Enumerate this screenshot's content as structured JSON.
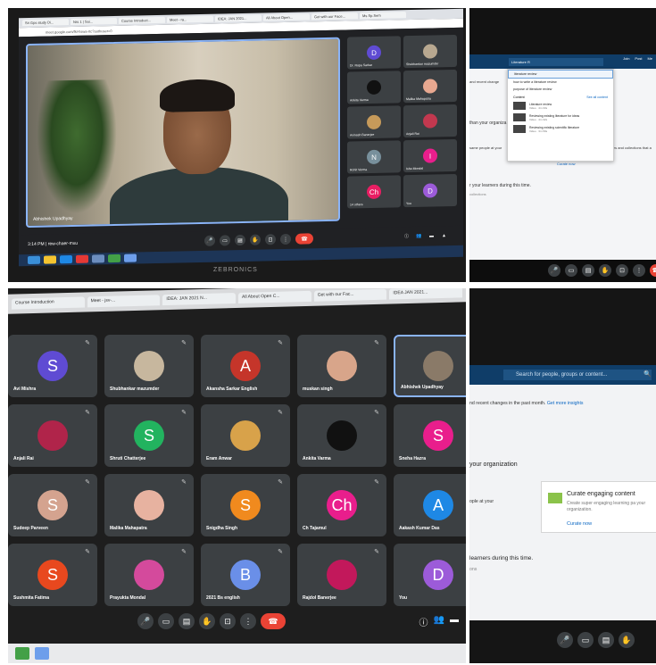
{
  "panel1": {
    "tabs": [
      "Sri Gps study Di...",
      "Nrs 1 | Sai...",
      "Course Introduct...",
      "Meet - ra...",
      "IDEA: JAN 2021...",
      "All About Open...",
      "Get with our Face...",
      "Ms Sp.Sem"
    ],
    "url": "meet.google.com/fkl-hswa-rtc?authuser=0",
    "speaker_name": "Abhishek Upadhyay",
    "participants": [
      {
        "name": "Dr. Rupa Sarkar",
        "initial": "D",
        "color": "#5f4bd3",
        "photo": false
      },
      {
        "name": "Shubhankar mazumder",
        "initial": "",
        "color": "#b8a890",
        "photo": true
      },
      {
        "name": "Ankita Varma",
        "initial": "",
        "color": "#111111",
        "photo": true
      },
      {
        "name": "Malika Mahapatra",
        "initial": "",
        "color": "#e8a890",
        "photo": true
      },
      {
        "name": "Avinash Banerjee",
        "initial": "",
        "color": "#c69a5a",
        "photo": true
      },
      {
        "name": "Anjali Rai",
        "initial": "",
        "color": "#c2384f",
        "photo": true
      },
      {
        "name": "Rohit Verma",
        "initial": "N",
        "color": "#78909c",
        "photo": false
      },
      {
        "name": "Isha Mondal",
        "initial": "I",
        "color": "#e91e8c",
        "photo": false
      },
      {
        "name": "14 others",
        "initial": "Ch",
        "color": "#e91e63",
        "photo": false
      },
      {
        "name": "You",
        "initial": "D",
        "color": "#9c5bd9",
        "photo": false
      }
    ],
    "time": "3:14 PM",
    "meeting_code": "rew-chaer-mxu",
    "brand": "ZEBRONICS"
  },
  "panel2": {
    "search_value": "Literature R",
    "header_icons": [
      "Join",
      "Post",
      "Me"
    ],
    "suggestions": [
      "literature review",
      "how to write a literature review",
      "purpose of literature review"
    ],
    "content_label": "Content",
    "see_all": "See all content",
    "content_items": [
      {
        "title": "Literature review",
        "meta": "Video · 4m 33s"
      },
      {
        "title": "Reviewing existing literature for ideas",
        "meta": "Video · 4m 32s"
      },
      {
        "title": "Reviewing existing scientific literature",
        "meta": "Video · 3m 59s"
      }
    ],
    "left_text1": "and recent change",
    "left_text2": "than your organiza",
    "left_text3": "same people at your",
    "right_text": "ies and collections that a",
    "curate_link": "Curate now",
    "bottom_heading": "r your learners during this time.",
    "bottom_sub": "collections"
  },
  "panel3": {
    "tabs": [
      "Course Introduction",
      "Meet - jsv-...",
      "IDEA: JAN 2021 N...",
      "All About Open C...",
      "Get with our Fac...",
      "IDEA JAN 2021..."
    ],
    "tiles": [
      {
        "name": "Avi Mishra",
        "initial": "S",
        "color": "#5f4bd3",
        "photo": false
      },
      {
        "name": "Shubhankar mazumder",
        "initial": "",
        "color": "#c7b79e",
        "photo": true
      },
      {
        "name": "Akansha Sarkar English",
        "initial": "A",
        "color": "#c5352a",
        "photo": false
      },
      {
        "name": "muskan singh",
        "initial": "",
        "color": "#d8a58a",
        "photo": true
      },
      {
        "name": "Abhishek Upadhyay",
        "initial": "",
        "color": "#8a7a68",
        "photo": true,
        "active": true
      },
      {
        "name": "Anjali Rai",
        "initial": "",
        "color": "#b0244a",
        "photo": true
      },
      {
        "name": "Shruti Chatterjee",
        "initial": "S",
        "color": "#22b35f",
        "photo": false
      },
      {
        "name": "Eram Anwar",
        "initial": "",
        "color": "#d8a24a",
        "photo": true
      },
      {
        "name": "Ankita Varma",
        "initial": "",
        "color": "#111111",
        "photo": true
      },
      {
        "name": "Sneha Hazra",
        "initial": "S",
        "color": "#e91e8c",
        "photo": false
      },
      {
        "name": "Sudeep Parveen",
        "initial": "S",
        "color": "#d4a38f",
        "photo": false
      },
      {
        "name": "Malika Mahapatra",
        "initial": "",
        "color": "#e7b2a0",
        "photo": true
      },
      {
        "name": "Snigdha Singh",
        "initial": "S",
        "color": "#f08a1e",
        "photo": false
      },
      {
        "name": "Ch Tajamul",
        "initial": "Ch",
        "color": "#e91e8c",
        "photo": false
      },
      {
        "name": "Aakash Kumar Das",
        "initial": "A",
        "color": "#1e88e5",
        "photo": false
      },
      {
        "name": "Sushmita Fatima",
        "initial": "S",
        "color": "#e8481e",
        "photo": false
      },
      {
        "name": "Prayukta Mondal",
        "initial": "",
        "color": "#d44a9c",
        "photo": true
      },
      {
        "name": "2021 Bs english",
        "initial": "B",
        "color": "#6a8fe8",
        "photo": false
      },
      {
        "name": "Rajdol Banerjee",
        "initial": "",
        "color": "#c2185b",
        "photo": true
      },
      {
        "name": "You",
        "initial": "D",
        "color": "#9c5bd9",
        "photo": false
      }
    ]
  },
  "panel4": {
    "search_placeholder": "Search for people, groups or content...",
    "text1": "nd recent changes in the past month.",
    "insights_link": "Get more insights",
    "org_heading": "your organization",
    "left_snip": "ople at your",
    "card_title": "Curate engaging content",
    "card_desc": "Create super engaging learning pa your organization.",
    "card_link": "Curate now",
    "learners_heading": "learners during this time.",
    "learners_sub": "ons"
  }
}
